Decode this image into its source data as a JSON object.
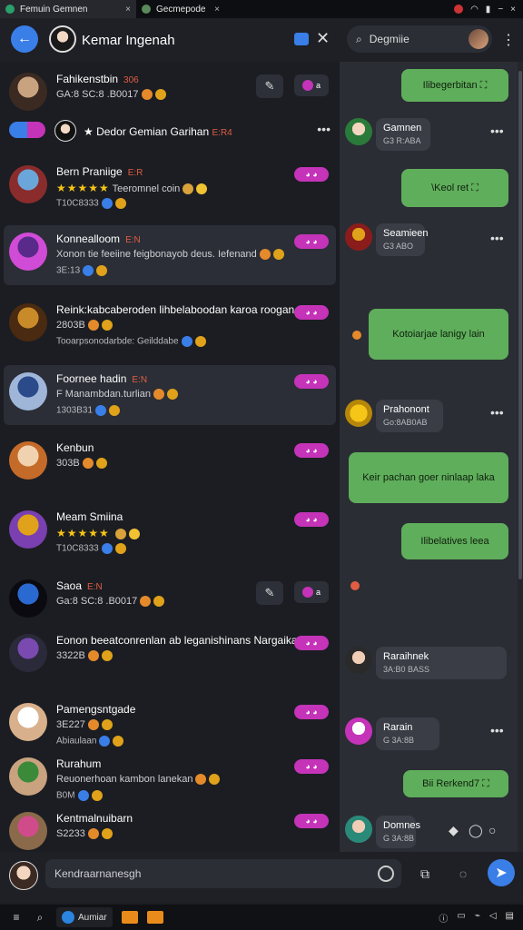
{
  "browser": {
    "tab1_title": "Femuin Gemnen",
    "tab2_title": "Gecmepode",
    "close_glyph": "×",
    "tray_icons": [
      "wifi-icon",
      "signal-icon",
      "minimize-icon",
      "close-icon"
    ]
  },
  "header": {
    "back_icon": "back-arrow-icon",
    "title": "Kemar Ingenah",
    "search_placeholder": "Degmiie",
    "more_icon": "⋮"
  },
  "filter_row": {
    "label": "★ Dedor Gemian Garihan",
    "tag": "E:R4",
    "dots": "•••"
  },
  "chats": [
    {
      "name": "Fahikenstbin",
      "tag": "306",
      "sub": "GA:8 SC:8 .B0017",
      "sub2": "",
      "pill": "",
      "selected": false,
      "edit": true,
      "avatar": [
        "#c9a27f",
        "#3b2a22"
      ]
    },
    {
      "name": "Bern Praniige",
      "tag": "E:R",
      "sub": "★★★★★ Teeromnel coin",
      "sub2": "T10C8333",
      "pill": "◕ ◕",
      "selected": false,
      "edit": false,
      "avatar": [
        "#6aa6d9",
        "#8b2c2c"
      ]
    },
    {
      "name": "Konnealloom",
      "tag": "E:N",
      "sub": "Xonon tie feeiine feigbonayob deus. Iefenand",
      "sub2": "3E:13",
      "pill": "◕ ◕",
      "selected": true,
      "edit": false,
      "avatar": [
        "#5a2a8a",
        "#d04bd6"
      ]
    },
    {
      "name": "Reink:kabcaberoden lihbelaboodan karoa roogan",
      "tag": "",
      "sub": "2803B",
      "sub2": "Tooarpsonodarbde: Geilddabe",
      "pill": "◕ ◕",
      "selected": false,
      "edit": false,
      "avatar": [
        "#c98b2a",
        "#4a2a10"
      ]
    },
    {
      "name": "Foornee hadin",
      "tag": "E:N",
      "sub": "F Manambdan.turlian",
      "sub2": "1303B31",
      "pill": "◕ ◕",
      "selected": true,
      "edit": false,
      "avatar": [
        "#2a4a8a",
        "#9fb6d9"
      ]
    },
    {
      "name": "Kenbun",
      "tag": "",
      "sub": "303B",
      "sub2": "",
      "pill": "◕ ◕",
      "selected": false,
      "edit": false,
      "avatar": [
        "#f0d2b0",
        "#c56b2a"
      ]
    },
    {
      "name": "Meam Smiina",
      "tag": "",
      "sub": "★★★★★",
      "sub2": "T10C8333",
      "pill": "◕ ◕",
      "selected": false,
      "edit": false,
      "avatar": [
        "#e0a21a",
        "#7a3fb0"
      ]
    },
    {
      "name": "Saoa",
      "tag": "E:N",
      "sub": "Ga:8 SC:8 .B0017",
      "sub2": "",
      "pill": "",
      "selected": false,
      "edit": true,
      "avatar": [
        "#2a6ad0",
        "#0a0a10"
      ]
    },
    {
      "name": "Eonon beeatconrenlan ab leganishinans Nargaikan",
      "tag": "",
      "sub": "3322B",
      "sub2": "",
      "pill": "◕ ◕",
      "selected": false,
      "edit": false,
      "avatar": [
        "#7a4ab0",
        "#2a2a3a"
      ]
    },
    {
      "name": "Pamengsntgade",
      "tag": "",
      "sub": "3E227",
      "sub2": "Abiaulaan",
      "pill": "◕ ◕",
      "selected": false,
      "edit": false,
      "avatar": [
        "#ffffff",
        "#d9b08c"
      ]
    },
    {
      "name": "Rurahum",
      "tag": "",
      "sub": "Reuonerhoan kambon lanekan",
      "sub2": "B0M",
      "pill": "◕ ◕",
      "selected": false,
      "edit": false,
      "avatar": [
        "#3a8a3a",
        "#c9a27f"
      ]
    },
    {
      "name": "Kentmalnuibarn",
      "tag": "",
      "sub": "S2233",
      "sub2": "",
      "pill": "◕ ◕",
      "selected": false,
      "edit": false,
      "avatar": [
        "#d04b8a",
        "#8a6a4a"
      ]
    }
  ],
  "conversation": {
    "bubbles": [
      {
        "text": "Ilibegerbitan ⛶"
      },
      {
        "text": "\\Keol ret ⛶"
      },
      {
        "text": "Kotoiarjae lanigy lain"
      },
      {
        "text": "Keir pachan goer ninlaap laka"
      },
      {
        "text": "Ilibelatives leea"
      },
      {
        "text": "Bii Rerkend7 ⛶"
      }
    ],
    "cards": [
      {
        "title": "Gamnen",
        "sub": "G3 R:ABA"
      },
      {
        "title": "Seamieen",
        "sub": "G3 ABO"
      },
      {
        "title": "Prahonont",
        "sub": "Go:8AB0AB"
      },
      {
        "title": "Raraihnek",
        "sub": "3A:B0 BASS"
      },
      {
        "title": "Rarain",
        "sub": "G 3A:8B"
      },
      {
        "title": "Domnes",
        "sub": "G 3A:8B"
      }
    ],
    "dots": "•••"
  },
  "composer": {
    "placeholder": "Kendraarnanesgh"
  },
  "taskbar": {
    "app_label": "Aumiar",
    "start_icon": "≡",
    "search_icon": "⌕"
  },
  "colors": {
    "accent_blue": "#3a7ee8",
    "pill_magenta": "#c433b8",
    "bubble_green": "#5fae5b",
    "panel_dark": "#1b1d22"
  }
}
